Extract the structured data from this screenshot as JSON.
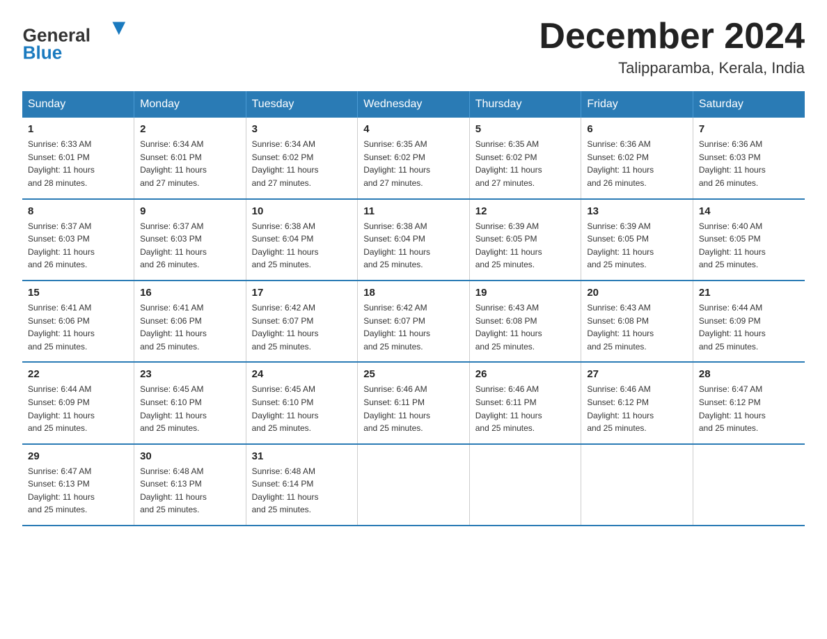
{
  "header": {
    "logo_general": "General",
    "logo_blue": "Blue",
    "month_title": "December 2024",
    "location": "Talipparamba, Kerala, India"
  },
  "days_of_week": [
    "Sunday",
    "Monday",
    "Tuesday",
    "Wednesday",
    "Thursday",
    "Friday",
    "Saturday"
  ],
  "weeks": [
    [
      {
        "day": "1",
        "sunrise": "6:33 AM",
        "sunset": "6:01 PM",
        "daylight": "11 hours and 28 minutes."
      },
      {
        "day": "2",
        "sunrise": "6:34 AM",
        "sunset": "6:01 PM",
        "daylight": "11 hours and 27 minutes."
      },
      {
        "day": "3",
        "sunrise": "6:34 AM",
        "sunset": "6:02 PM",
        "daylight": "11 hours and 27 minutes."
      },
      {
        "day": "4",
        "sunrise": "6:35 AM",
        "sunset": "6:02 PM",
        "daylight": "11 hours and 27 minutes."
      },
      {
        "day": "5",
        "sunrise": "6:35 AM",
        "sunset": "6:02 PM",
        "daylight": "11 hours and 27 minutes."
      },
      {
        "day": "6",
        "sunrise": "6:36 AM",
        "sunset": "6:02 PM",
        "daylight": "11 hours and 26 minutes."
      },
      {
        "day": "7",
        "sunrise": "6:36 AM",
        "sunset": "6:03 PM",
        "daylight": "11 hours and 26 minutes."
      }
    ],
    [
      {
        "day": "8",
        "sunrise": "6:37 AM",
        "sunset": "6:03 PM",
        "daylight": "11 hours and 26 minutes."
      },
      {
        "day": "9",
        "sunrise": "6:37 AM",
        "sunset": "6:03 PM",
        "daylight": "11 hours and 26 minutes."
      },
      {
        "day": "10",
        "sunrise": "6:38 AM",
        "sunset": "6:04 PM",
        "daylight": "11 hours and 25 minutes."
      },
      {
        "day": "11",
        "sunrise": "6:38 AM",
        "sunset": "6:04 PM",
        "daylight": "11 hours and 25 minutes."
      },
      {
        "day": "12",
        "sunrise": "6:39 AM",
        "sunset": "6:05 PM",
        "daylight": "11 hours and 25 minutes."
      },
      {
        "day": "13",
        "sunrise": "6:39 AM",
        "sunset": "6:05 PM",
        "daylight": "11 hours and 25 minutes."
      },
      {
        "day": "14",
        "sunrise": "6:40 AM",
        "sunset": "6:05 PM",
        "daylight": "11 hours and 25 minutes."
      }
    ],
    [
      {
        "day": "15",
        "sunrise": "6:41 AM",
        "sunset": "6:06 PM",
        "daylight": "11 hours and 25 minutes."
      },
      {
        "day": "16",
        "sunrise": "6:41 AM",
        "sunset": "6:06 PM",
        "daylight": "11 hours and 25 minutes."
      },
      {
        "day": "17",
        "sunrise": "6:42 AM",
        "sunset": "6:07 PM",
        "daylight": "11 hours and 25 minutes."
      },
      {
        "day": "18",
        "sunrise": "6:42 AM",
        "sunset": "6:07 PM",
        "daylight": "11 hours and 25 minutes."
      },
      {
        "day": "19",
        "sunrise": "6:43 AM",
        "sunset": "6:08 PM",
        "daylight": "11 hours and 25 minutes."
      },
      {
        "day": "20",
        "sunrise": "6:43 AM",
        "sunset": "6:08 PM",
        "daylight": "11 hours and 25 minutes."
      },
      {
        "day": "21",
        "sunrise": "6:44 AM",
        "sunset": "6:09 PM",
        "daylight": "11 hours and 25 minutes."
      }
    ],
    [
      {
        "day": "22",
        "sunrise": "6:44 AM",
        "sunset": "6:09 PM",
        "daylight": "11 hours and 25 minutes."
      },
      {
        "day": "23",
        "sunrise": "6:45 AM",
        "sunset": "6:10 PM",
        "daylight": "11 hours and 25 minutes."
      },
      {
        "day": "24",
        "sunrise": "6:45 AM",
        "sunset": "6:10 PM",
        "daylight": "11 hours and 25 minutes."
      },
      {
        "day": "25",
        "sunrise": "6:46 AM",
        "sunset": "6:11 PM",
        "daylight": "11 hours and 25 minutes."
      },
      {
        "day": "26",
        "sunrise": "6:46 AM",
        "sunset": "6:11 PM",
        "daylight": "11 hours and 25 minutes."
      },
      {
        "day": "27",
        "sunrise": "6:46 AM",
        "sunset": "6:12 PM",
        "daylight": "11 hours and 25 minutes."
      },
      {
        "day": "28",
        "sunrise": "6:47 AM",
        "sunset": "6:12 PM",
        "daylight": "11 hours and 25 minutes."
      }
    ],
    [
      {
        "day": "29",
        "sunrise": "6:47 AM",
        "sunset": "6:13 PM",
        "daylight": "11 hours and 25 minutes."
      },
      {
        "day": "30",
        "sunrise": "6:48 AM",
        "sunset": "6:13 PM",
        "daylight": "11 hours and 25 minutes."
      },
      {
        "day": "31",
        "sunrise": "6:48 AM",
        "sunset": "6:14 PM",
        "daylight": "11 hours and 25 minutes."
      },
      null,
      null,
      null,
      null
    ]
  ],
  "labels": {
    "sunrise": "Sunrise:",
    "sunset": "Sunset:",
    "daylight": "Daylight:"
  }
}
